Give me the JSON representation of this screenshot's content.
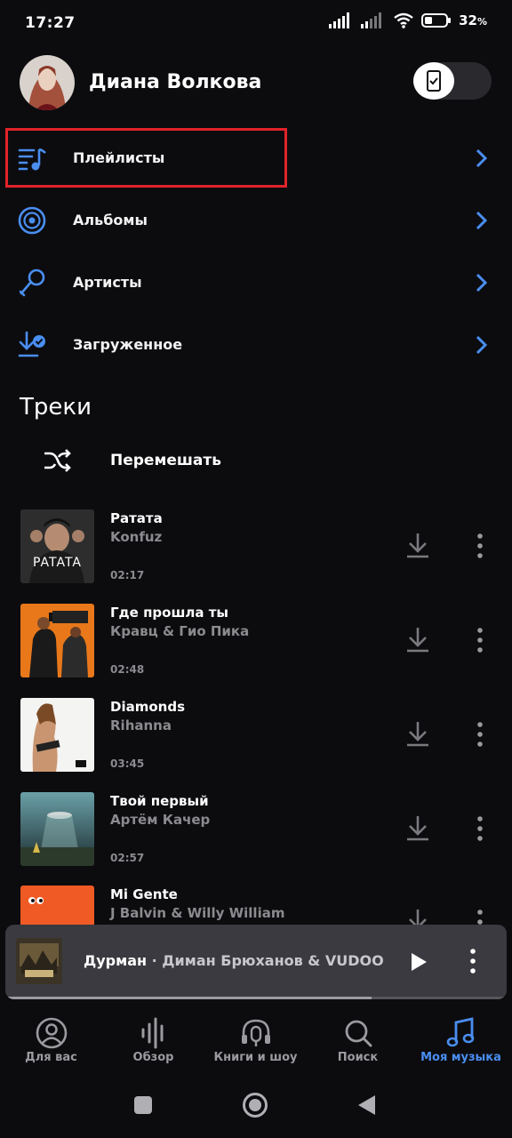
{
  "status_bar": {
    "time": "17:27",
    "battery": "32",
    "battery_unit": "%"
  },
  "header": {
    "user_name": "Диана Волкова"
  },
  "menu": [
    {
      "label": "Плейлисты",
      "icon": "playlist-icon"
    },
    {
      "label": "Альбомы",
      "icon": "album-icon"
    },
    {
      "label": "Артисты",
      "icon": "microphone-icon"
    },
    {
      "label": "Загруженное",
      "icon": "downloaded-icon"
    }
  ],
  "tracks_section": {
    "title": "Треки",
    "shuffle_label": "Перемешать"
  },
  "tracks": [
    {
      "title": "Ратата",
      "artist": "Konfuz",
      "duration": "02:17",
      "cover_text": "PATATA"
    },
    {
      "title": "Где прошла ты",
      "artist": "Кравц & Гио Пика",
      "duration": "02:48"
    },
    {
      "title": "Diamonds",
      "artist": "Rihanna",
      "duration": "03:45"
    },
    {
      "title": "Твой первый",
      "artist": "Артём Качер",
      "duration": "02:57"
    },
    {
      "title": "Mi Gente",
      "artist": "J Balvin & Willy William",
      "duration": ""
    }
  ],
  "mini_player": {
    "title": "Дурман",
    "separator": " · ",
    "artist": "Диман Брюханов & VUDOO",
    "progress": 0.73
  },
  "bottom_nav": [
    {
      "label": "Для вас",
      "icon": "user-circle-icon"
    },
    {
      "label": "Обзор",
      "icon": "waveform-icon"
    },
    {
      "label": "Книги и шоу",
      "icon": "headphones-mic-icon"
    },
    {
      "label": "Поиск",
      "icon": "search-icon"
    },
    {
      "label": "Моя музыка",
      "icon": "music-note-icon",
      "active": true
    }
  ],
  "colors": {
    "accent": "#4a8ef0",
    "highlight": "#e0242a",
    "background": "#0c0c0f",
    "secondary_text": "#8b8b8f"
  }
}
